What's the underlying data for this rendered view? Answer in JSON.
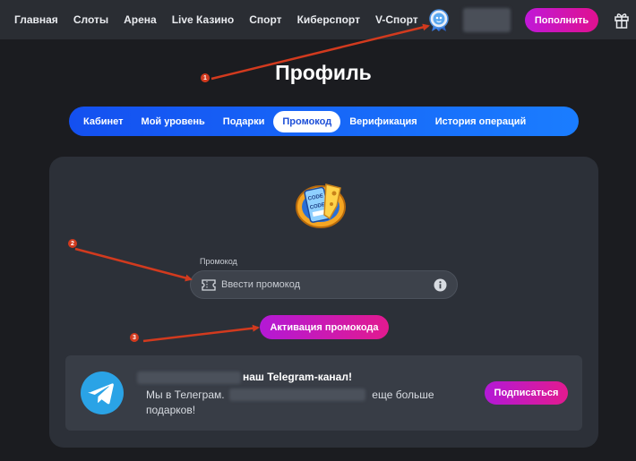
{
  "nav": {
    "items": [
      "Главная",
      "Слоты",
      "Арена",
      "Live Казино",
      "Спорт",
      "Киберспорт",
      "V-Спорт"
    ],
    "deposit_label": "Пополнить"
  },
  "page": {
    "title": "Профиль"
  },
  "tabs": {
    "items": [
      {
        "label": "Кабинет",
        "active": false
      },
      {
        "label": "Мой уровень",
        "active": false
      },
      {
        "label": "Подарки",
        "active": false
      },
      {
        "label": "Промокод",
        "active": true
      },
      {
        "label": "Верификация",
        "active": false
      },
      {
        "label": "История операций",
        "active": false
      }
    ]
  },
  "promo": {
    "icon_text": [
      "CODE",
      "CODE"
    ],
    "field_label": "Промокод",
    "placeholder": "Ввести промокод",
    "value": "",
    "activate_label": "Активация промокода"
  },
  "telegram": {
    "title": "наш Telegram-канал!",
    "text_start": "Мы в Телеграм.",
    "text_end": "еще больше",
    "text_line2": "подарков!",
    "subscribe_label": "Подписаться"
  },
  "annotations": [
    "1",
    "2",
    "3"
  ],
  "colors": {
    "tab_bar": "#1a66f7",
    "primary_button": "#d01ab0",
    "background": "#1b1c20",
    "card": "#2c3038",
    "arrow": "#d23a1e"
  }
}
